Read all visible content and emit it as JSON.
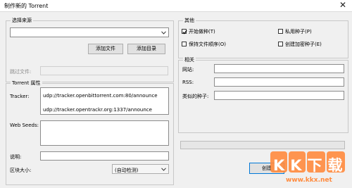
{
  "window": {
    "title": "制作新的 Torrent",
    "close_glyph": "✕"
  },
  "source": {
    "group_title": "选择来源",
    "combo_value": "",
    "add_file": "添加文件",
    "add_dir": "添加目录",
    "skip_label": "跳过文件:",
    "skip_value": ""
  },
  "props": {
    "group_title": "Torrent 属性",
    "tracker_label": "Tracker:",
    "trackers": [
      "udp://tracker.openbittorrent.com:80/announce",
      "udp://tracker.opentrackr.org:1337/announce"
    ],
    "webseeds_label": "Web Seeds:",
    "webseeds_value": "",
    "comment_label": "说明:",
    "comment_value": "",
    "piece_label": "区块大小:",
    "piece_value": "(自动检测)"
  },
  "other": {
    "group_title": "其他",
    "start_seeding": {
      "label": "开始做种(T)",
      "checked": true
    },
    "private_torrent": {
      "label": "私用种子(P)",
      "checked": false
    },
    "keep_order": {
      "label": "保持文件顺序(O)",
      "checked": false
    },
    "encrypted": {
      "label": "创建加密种子(E)",
      "checked": false
    }
  },
  "related": {
    "group_title": "相关",
    "website_label": "网站:",
    "website_value": "",
    "rss_label": "RSS:",
    "rss_value": "",
    "similar_label": "类似的种子:",
    "similar_value": ""
  },
  "progress": {
    "value": 0
  },
  "create_label": "创建",
  "watermark": {
    "logo_text": "KK下载",
    "url_text": "www.kkx.net",
    "color": "#ff8a3d"
  }
}
